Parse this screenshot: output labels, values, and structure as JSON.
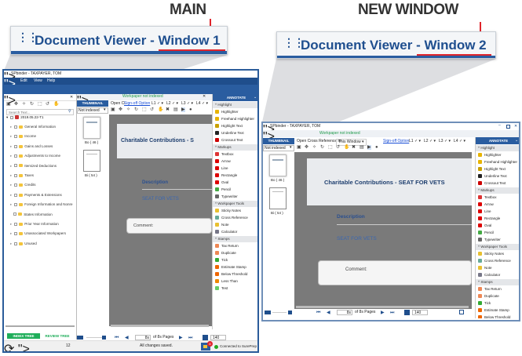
{
  "labels": {
    "main": "MAIN",
    "new_window": "NEW WINDOW"
  },
  "banners": {
    "main": "Document Viewer - Window 1",
    "new": "Document Viewer - Window 2"
  },
  "colors": {
    "brand": "#1f4e8c",
    "accent_red": "#e0242b",
    "green": "#1f9a4a"
  },
  "main": {
    "title": "SPbinder - TAXPAYER, TOM",
    "menu": [
      "Binder",
      "Edit",
      "View",
      "Help"
    ],
    "tree": {
      "header": "Index/Review Tree",
      "search_placeholder": "Search Text...",
      "root": "2019.05.22-T1",
      "items": [
        "General Information",
        "Income",
        "Gains and Losses",
        "Adjustments to Income",
        "Itemized Deductions",
        "Taxes",
        "Credits",
        "Payments & Extensions",
        "Foreign Information and Nonre",
        "States Information",
        "Prior Year Information",
        "Unassociated Workpapers",
        "Unused"
      ],
      "tabs": [
        "INDEX TREE",
        "REVIEW TREE"
      ]
    },
    "viewer": {
      "tab": "Document Viewer - Window 1",
      "status": "Workpaper not indexed",
      "open_xref": "Open Cl",
      "signoff": "Sign-off Option",
      "levels": [
        "L1",
        "L2",
        "L3",
        "L4"
      ],
      "thumb_header": "THUMBNAIL",
      "filter": "Not indexed",
      "thumbs": [
        "Bo ( 46 )",
        "Bi ( 54 )"
      ],
      "doc_title": "Charitable Contributions - S",
      "desc_label": "Description",
      "desc_value": "SEAT FOR VETS",
      "comment": "Comment:",
      "page": "8s",
      "of_pages": "of  8s Pages",
      "zoom": "140"
    },
    "status": {
      "sync_count": "12",
      "saved": "All changes saved.",
      "badge": "8",
      "connection": "Connected to SurePrep"
    }
  },
  "annotate": {
    "header": "ANNOTATE",
    "sections": [
      {
        "title": "Highlight",
        "items": [
          "Highlighter",
          "Freehand Highlighter",
          "Highlight Text",
          "Underline Text",
          "Crossout Text"
        ]
      },
      {
        "title": "Markups",
        "items": [
          "Textbox",
          "Arrow",
          "Line",
          "Rectangle",
          "Oval",
          "Pencil",
          "Typewriter"
        ]
      },
      {
        "title": "Workpaper Tools",
        "items": [
          "Sticky Notes",
          "Cross Reference",
          "Note",
          "Calculator"
        ]
      },
      {
        "title": "Stamps",
        "items": [
          "Tax Return",
          "Duplicate",
          "Tick",
          "Estimate Stamp",
          "Below Threshold",
          "Less Than",
          "Test"
        ]
      }
    ]
  },
  "newwin": {
    "title": "SPbinder - TAXPAYER, TOM",
    "tab": "Document Viewer - Window 2",
    "status": "Workpaper not indexed",
    "open_xref": "Open Cross Reference in:",
    "xref_value": "This Window",
    "signoff": "Sign-off Option",
    "levels": [
      "L1",
      "L2",
      "L3",
      "L4"
    ],
    "thumb_header": "THUMBNAIL",
    "filter": "Not indexed",
    "thumbs": [
      "Bo ( 46 )",
      "Bi ( 54 )"
    ],
    "doc_title": "Charitable Contributions - SEAT FOR VETS",
    "desc_label": "Description",
    "desc_value": "SEAT FOR VETS",
    "comment": "Comment:",
    "page": "8s",
    "of_pages": "of  8s Pages",
    "zoom": "140"
  }
}
